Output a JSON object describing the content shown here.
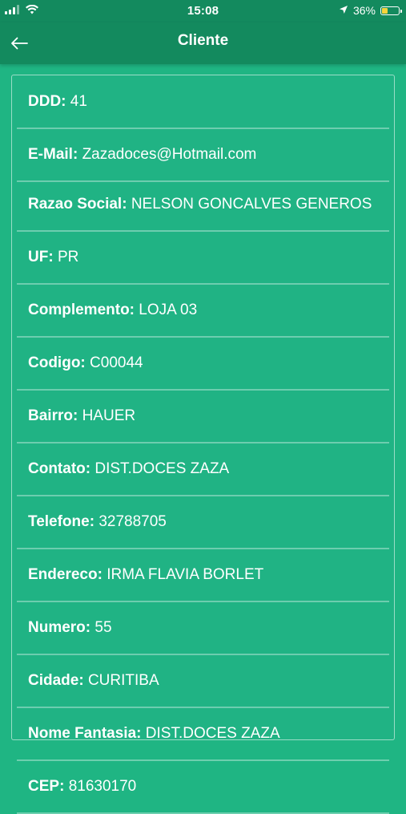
{
  "status_bar": {
    "time": "15:08",
    "battery_percent": "36%",
    "battery_level": 0.36,
    "battery_color": "#f5d33a",
    "icons": [
      "signal-icon",
      "wifi-icon",
      "location-icon",
      "battery-icon"
    ]
  },
  "app_bar": {
    "title": "Cliente",
    "back_icon": "arrow-left-icon",
    "color": "#138a5e"
  },
  "theme": {
    "background": "#1fb583",
    "text": "#ffffff"
  },
  "fields": [
    {
      "label": "DDD:",
      "value": "41"
    },
    {
      "label": "E-Mail:",
      "value": "Zazadoces@Hotmail.com"
    },
    {
      "label": "Razao Social:",
      "value": "NELSON GONCALVES GENEROS"
    },
    {
      "label": "UF:",
      "value": "PR"
    },
    {
      "label": "Complemento:",
      "value": "LOJA 03"
    },
    {
      "label": "Codigo:",
      "value": "C00044"
    },
    {
      "label": "Bairro:",
      "value": "HAUER"
    },
    {
      "label": "Contato:",
      "value": "DIST.DOCES ZAZA"
    },
    {
      "label": "Telefone:",
      "value": "32788705"
    },
    {
      "label": "Endereco:",
      "value": "IRMA FLAVIA BORLET"
    },
    {
      "label": "Numero:",
      "value": "55"
    },
    {
      "label": "Cidade:",
      "value": "CURITIBA"
    },
    {
      "label": "Nome Fantasia:",
      "value": "DIST.DOCES ZAZA"
    },
    {
      "label": "CEP:",
      "value": "81630170"
    }
  ]
}
